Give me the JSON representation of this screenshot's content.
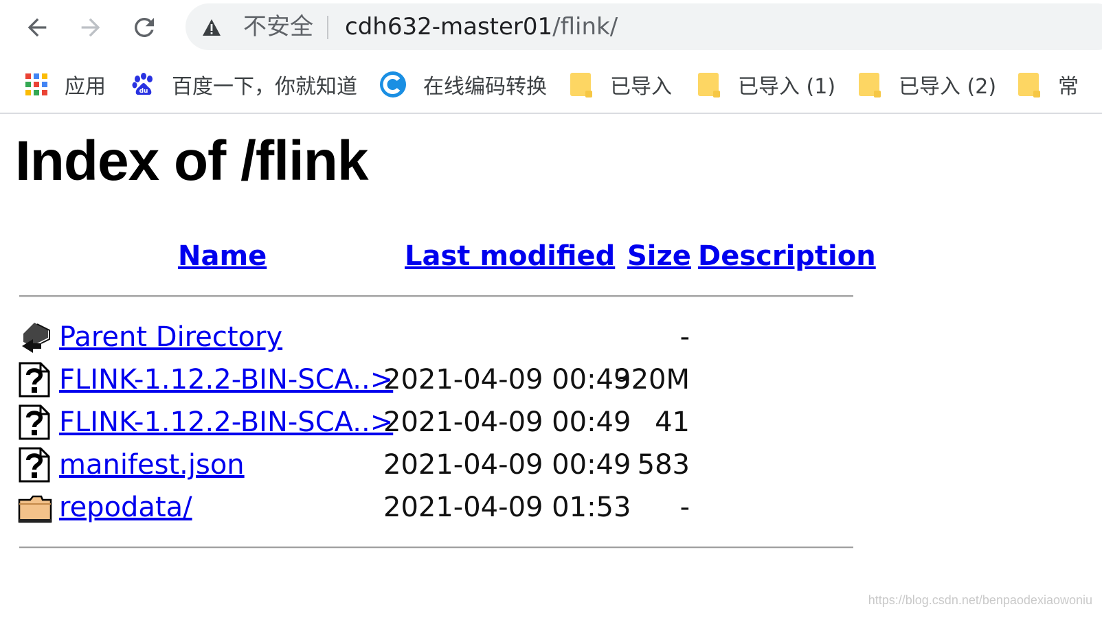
{
  "browser": {
    "security_label": "不安全",
    "url_host": "cdh632-master01",
    "url_path": "/flink/"
  },
  "bookmarks": [
    {
      "label": "应用",
      "icon": "apps-grid-icon"
    },
    {
      "label": "百度一下，你就知道",
      "icon": "baidu-paw-icon"
    },
    {
      "label": "在线编码转换",
      "icon": "c-logo-icon"
    },
    {
      "label": "已导入",
      "icon": "folder-icon"
    },
    {
      "label": "已导入 (1)",
      "icon": "folder-icon"
    },
    {
      "label": "已导入 (2)",
      "icon": "folder-icon"
    },
    {
      "label": "常",
      "icon": "folder-icon"
    }
  ],
  "page": {
    "title": "Index of /flink",
    "columns": {
      "name": "Name",
      "last_modified": "Last modified",
      "size": "Size",
      "description": "Description"
    },
    "rows": [
      {
        "name": "Parent Directory",
        "date": "",
        "size": "-",
        "icon": "parent-directory-icon"
      },
      {
        "name": "FLINK-1.12.2-BIN-SCA..>",
        "date": "2021-04-09 00:49",
        "size": "320M",
        "icon": "unknown-file-icon"
      },
      {
        "name": "FLINK-1.12.2-BIN-SCA..>",
        "date": "2021-04-09 00:49",
        "size": "41",
        "icon": "unknown-file-icon"
      },
      {
        "name": "manifest.json",
        "date": "2021-04-09 00:49",
        "size": "583",
        "icon": "unknown-file-icon"
      },
      {
        "name": "repodata/",
        "date": "2021-04-09 01:53",
        "size": "-",
        "icon": "folder-icon"
      }
    ]
  },
  "watermark": "https://blog.csdn.net/benpaodexiaowoniu"
}
